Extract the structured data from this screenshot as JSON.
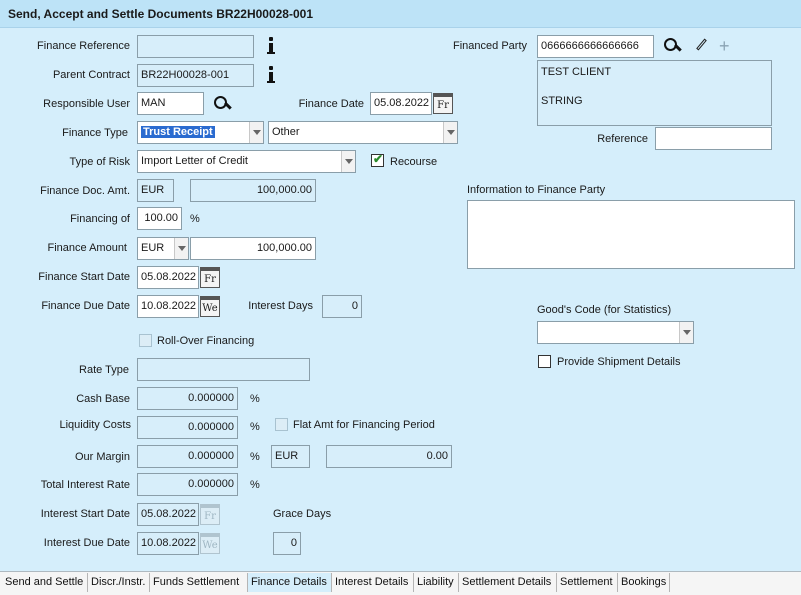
{
  "window": {
    "title": "Send, Accept and Settle Documents BR22H00028-001"
  },
  "form": {
    "finance_reference_label": "Finance Reference",
    "finance_reference_value": "",
    "parent_contract_label": "Parent Contract",
    "parent_contract_value": "BR22H00028-001",
    "responsible_user_label": "Responsible User",
    "responsible_user_value": "MAN",
    "finance_date_label": "Finance Date",
    "finance_date_value": "05.08.2022",
    "finance_date_day": "Fr",
    "finance_type_label": "Finance Type",
    "finance_type_value": "Trust Receipt",
    "finance_type_secondary": "Other",
    "type_of_risk_label": "Type of Risk",
    "type_of_risk_value": "Import Letter of Credit",
    "recourse_label": "Recourse",
    "recourse_checked": true,
    "finance_doc_amt_label": "Finance Doc. Amt.",
    "finance_doc_currency": "EUR",
    "finance_doc_amount": "100,000.00",
    "financing_of_label": "Financing of",
    "financing_of_value": "100.00",
    "percent": "%",
    "finance_amount_label": "Finance Amount",
    "finance_amount_currency": "EUR",
    "finance_amount_value": "100,000.00",
    "finance_start_date_label": "Finance Start Date",
    "finance_start_date_value": "05.08.2022",
    "finance_start_day": "Fr",
    "finance_due_date_label": "Finance Due Date",
    "finance_due_date_value": "10.08.2022",
    "finance_due_day": "We",
    "interest_days_label": "Interest Days",
    "interest_days_value": "0",
    "rollover_label": "Roll-Over Financing",
    "rate_type_label": "Rate Type",
    "rate_type_value": "",
    "cash_base_label": "Cash Base",
    "cash_base_value": "0.000000",
    "liquidity_costs_label": "Liquidity Costs",
    "liquidity_costs_value": "0.000000",
    "flat_amt_label": "Flat Amt for Financing Period",
    "our_margin_label": "Our Margin",
    "our_margin_value": "0.000000",
    "our_margin_currency": "EUR",
    "our_margin_amount": "0.00",
    "total_interest_rate_label": "Total Interest Rate",
    "total_interest_rate_value": "0.000000",
    "interest_start_date_label": "Interest Start Date",
    "interest_start_date_value": "05.08.2022",
    "interest_start_day": "Fr",
    "grace_days_label": "Grace Days",
    "grace_days_value": "0",
    "interest_due_date_label": "Interest Due Date",
    "interest_due_date_value": "10.08.2022",
    "interest_due_day": "We",
    "financed_party_label": "Financed Party",
    "financed_party_value": "0666666666666666",
    "financed_party_name": "TEST CLIENT",
    "financed_party_address": "STRING",
    "reference_label": "Reference",
    "reference_value": "",
    "info_to_party_label": "Information to Finance Party",
    "goods_code_label": "Good's Code (for Statistics)",
    "goods_code_value": "",
    "shipment_details_label": "Provide Shipment Details"
  },
  "tabs": [
    {
      "label": "Send and Settle"
    },
    {
      "label": "Discr./Instr."
    },
    {
      "label": "Funds Settlement"
    },
    {
      "label": "Finance Details",
      "active": true
    },
    {
      "label": "Interest Details"
    },
    {
      "label": "Liability"
    },
    {
      "label": "Settlement Details"
    },
    {
      "label": "Settlement"
    },
    {
      "label": "Bookings"
    }
  ],
  "icons": {
    "info": "info-icon",
    "search": "search-icon",
    "calendar": "calendar-icon",
    "edit": "pencil-icon",
    "add": "plus-icon"
  }
}
